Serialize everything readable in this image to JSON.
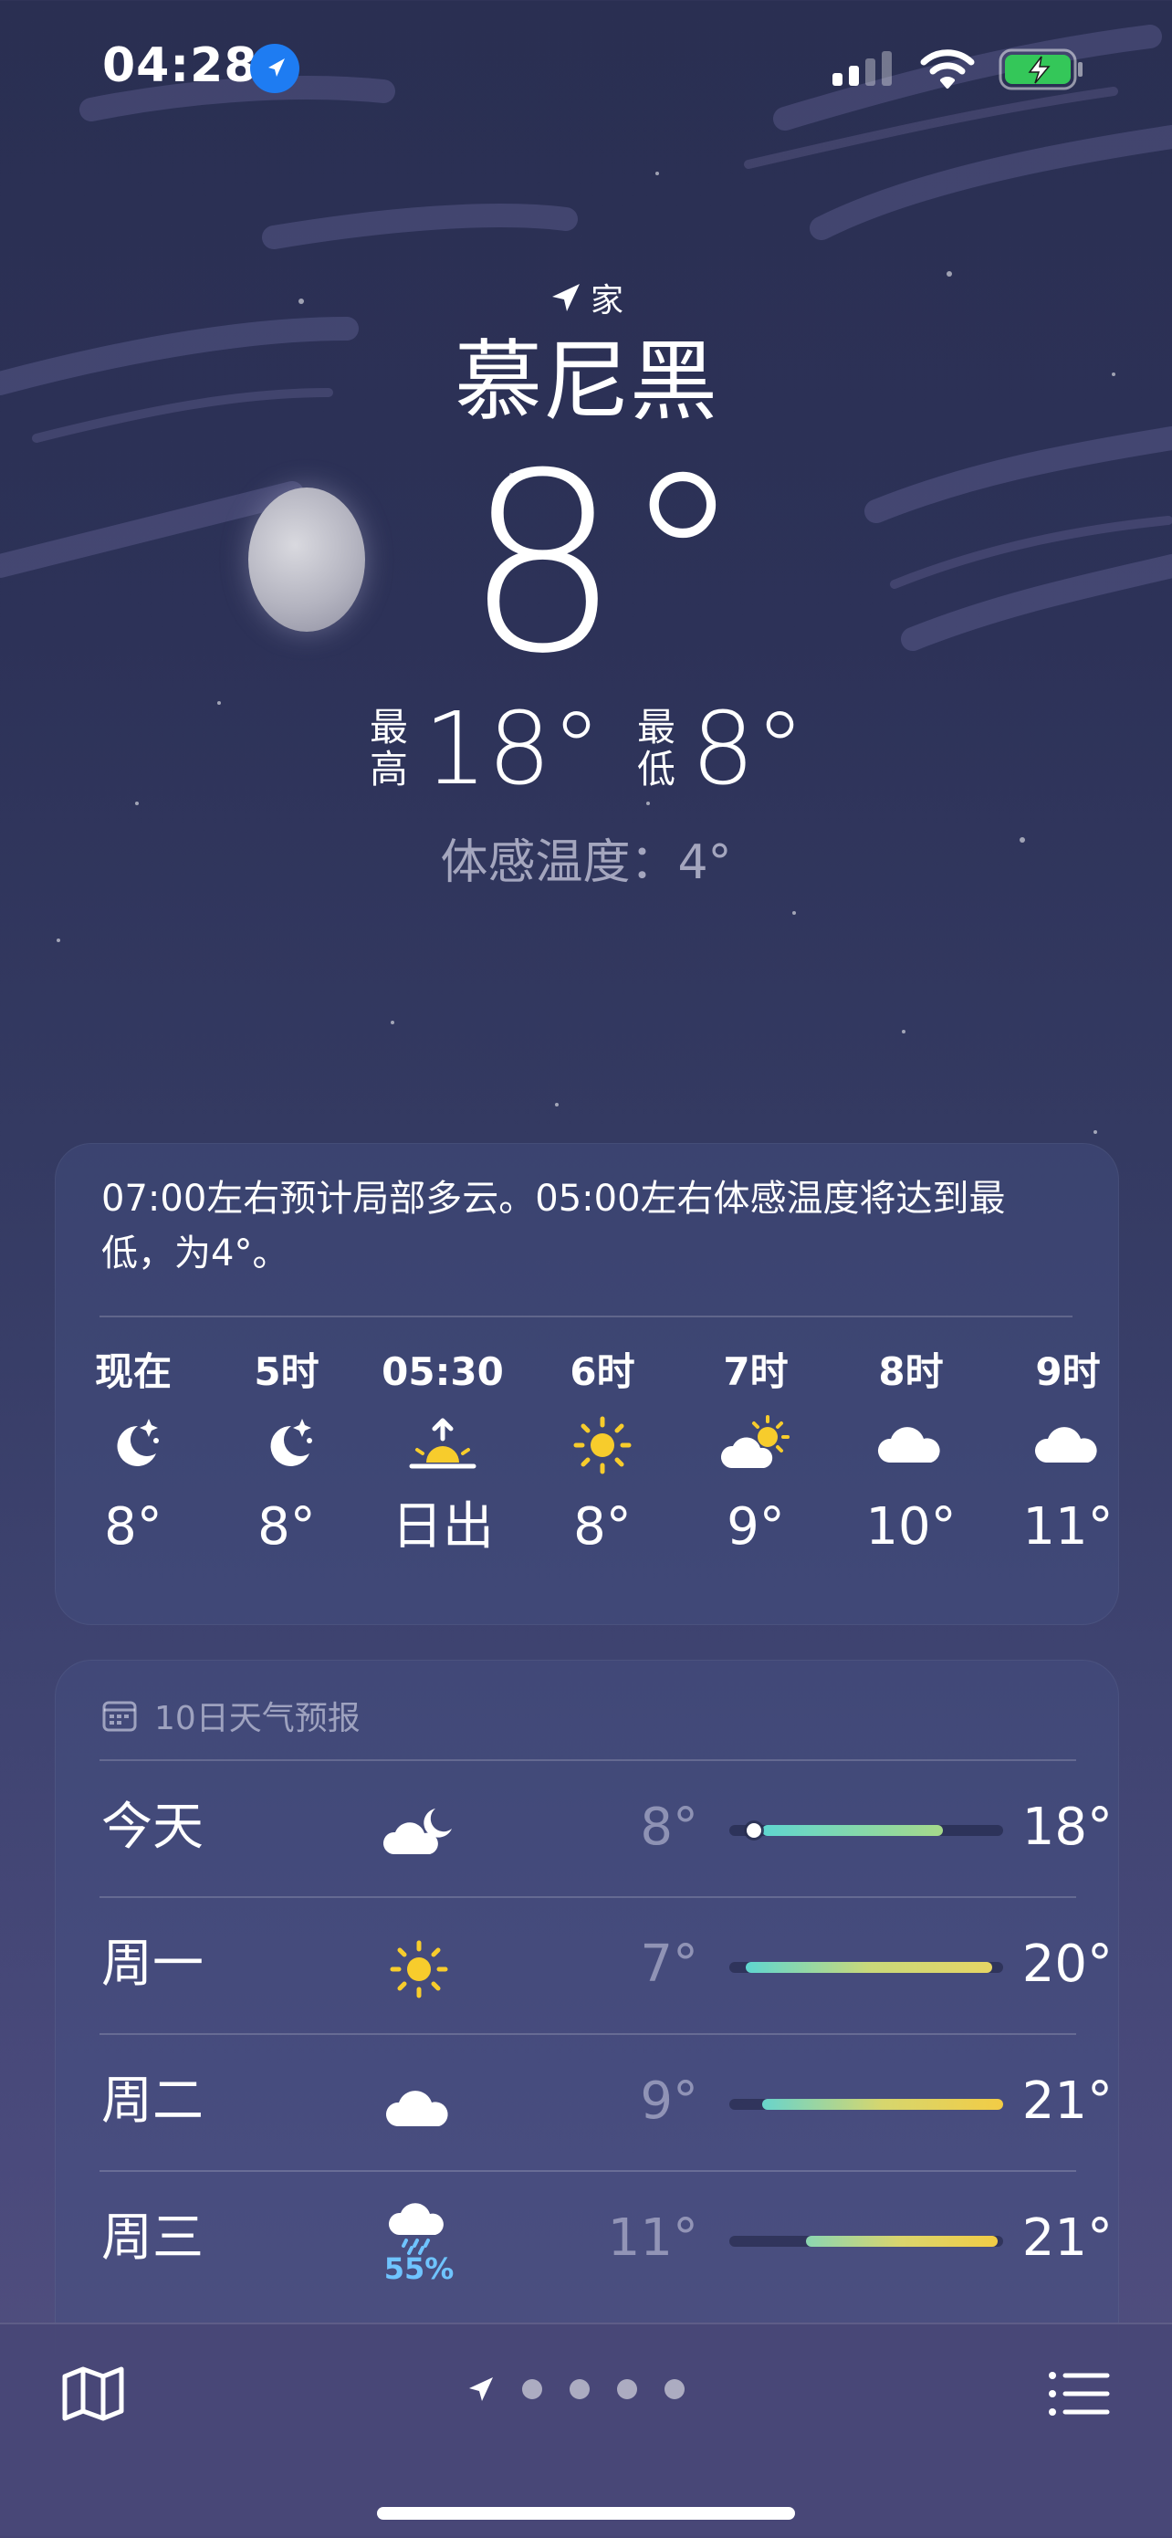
{
  "status_bar": {
    "time": "04:28",
    "icons": [
      "location-icon",
      "cellular-signal-icon",
      "wifi-icon",
      "battery-charging-icon"
    ]
  },
  "header": {
    "home_label": "家",
    "city": "慕尼黑",
    "temperature": "8°",
    "high_label": "最高",
    "high": "18°",
    "low_label": "最低",
    "low": "8°",
    "feels_like": "体感温度：4°"
  },
  "hourly": {
    "summary": "07:00左右预计局部多云。05:00左右体感温度将达到最低，为4°。",
    "items": [
      {
        "time": "现在",
        "icon": "moon-stars-icon",
        "temp": "8°"
      },
      {
        "time": "5时",
        "icon": "moon-stars-icon",
        "temp": "8°"
      },
      {
        "time": "05:30",
        "icon": "sunrise-icon",
        "temp": "日出"
      },
      {
        "time": "6时",
        "icon": "sun-icon",
        "temp": "8°"
      },
      {
        "time": "7时",
        "icon": "partly-cloudy-icon",
        "temp": "9°"
      },
      {
        "time": "8时",
        "icon": "cloud-icon",
        "temp": "10°"
      },
      {
        "time": "9时",
        "icon": "cloud-icon",
        "temp": "11°"
      }
    ]
  },
  "daily": {
    "title": "10日天气预报",
    "rows": [
      {
        "day": "今天",
        "icon": "cloud-moon-icon",
        "precip": "",
        "low": "8°",
        "high": "18°",
        "range_start": 0.12,
        "range_end": 0.78,
        "current": 0.09
      },
      {
        "day": "周一",
        "icon": "sun-icon",
        "precip": "",
        "low": "7°",
        "high": "20°",
        "range_start": 0.06,
        "range_end": 0.96
      },
      {
        "day": "周二",
        "icon": "cloud-icon",
        "precip": "",
        "low": "9°",
        "high": "21°",
        "range_start": 0.12,
        "range_end": 1.0
      },
      {
        "day": "周三",
        "icon": "cloud-rain-icon",
        "precip": "55%",
        "low": "11°",
        "high": "21°",
        "range_start": 0.28,
        "range_end": 0.98
      }
    ]
  },
  "colors": {
    "accent_blue": "#1e7cf2",
    "sun_yellow": "#f7cc2c",
    "precip_blue": "#6fc4ff",
    "battery_green": "#34c759"
  }
}
